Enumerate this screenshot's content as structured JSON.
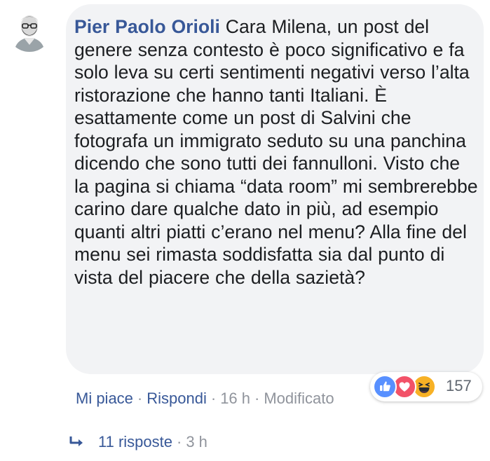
{
  "comment": {
    "author": "Pier Paolo Orioli",
    "text": "Cara Milena, un post del genere senza contesto è poco significativo e fa solo leva su certi sentimenti negativi verso l’alta ristorazione che hanno tanti Italiani. È esattamente come un post di Salvini che fotografa un immigrato seduto su una panchina dicendo che sono tutti dei fannulloni. Visto che la pagina si chiama “data room” mi sembrerebbe carino dare qualche dato in più, ad esempio quanti altri piatti c’erano nel menu? Alla fine del menu sei rimasta soddisfatta sia dal punto di vista del piacere che della sazietà?"
  },
  "reactions": {
    "types": [
      "like-icon",
      "love-icon",
      "haha-icon"
    ],
    "count": "157",
    "colors": {
      "like": "#5890ff",
      "love": "#f25268",
      "haha": "#f7b125"
    }
  },
  "actions": {
    "like_label": "Mi piace",
    "reply_label": "Rispondi",
    "time": "16 h",
    "edited_label": "Modificato",
    "separator": "·"
  },
  "replies": {
    "label": "11 risposte",
    "time": "3 h",
    "separator": "·"
  },
  "colors": {
    "link": "#385898",
    "meta": "#90949c",
    "bubble": "#f2f3f5",
    "text": "#1c1e21"
  }
}
